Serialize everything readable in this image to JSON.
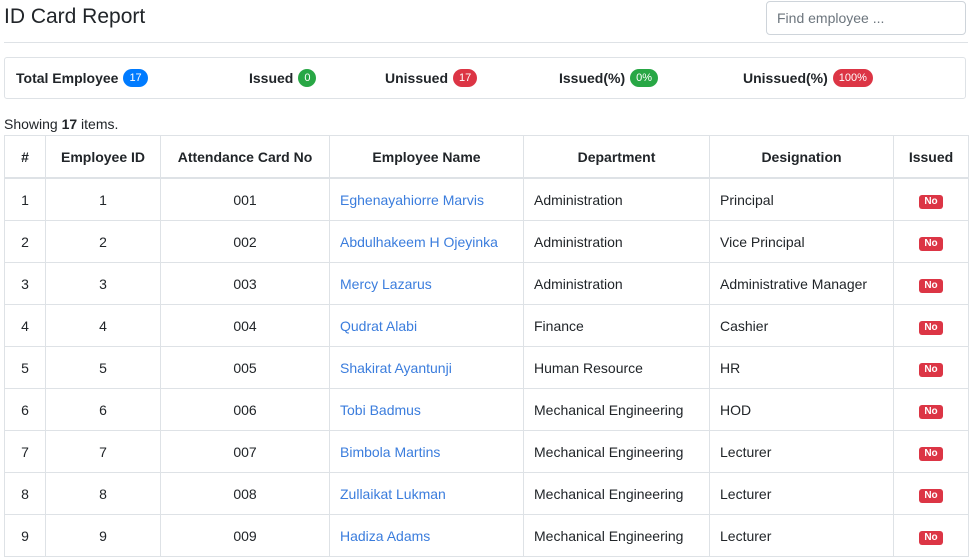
{
  "page": {
    "title": "ID Card Report",
    "search_placeholder": "Find employee ..."
  },
  "summary": {
    "total_label": "Total Employee",
    "total_value": "17",
    "issued_label": "Issued",
    "issued_value": "0",
    "unissued_label": "Unissued",
    "unissued_value": "17",
    "issued_pct_label": "Issued(%)",
    "issued_pct_value": "0%",
    "unissued_pct_label": "Unissued(%)",
    "unissued_pct_value": "100%"
  },
  "showing": {
    "prefix": "Showing ",
    "count": "17",
    "suffix": " items."
  },
  "table": {
    "headers": [
      "#",
      "Employee ID",
      "Attendance Card No",
      "Employee Name",
      "Department",
      "Designation",
      "Issued"
    ],
    "rows": [
      {
        "num": "1",
        "emp_id": "1",
        "card_no": "001",
        "name": "Eghenayahiorre Marvis",
        "department": "Administration",
        "designation": "Principal",
        "issued": "No"
      },
      {
        "num": "2",
        "emp_id": "2",
        "card_no": "002",
        "name": "Abdulhakeem H Ojeyinka",
        "department": "Administration",
        "designation": "Vice Principal",
        "issued": "No"
      },
      {
        "num": "3",
        "emp_id": "3",
        "card_no": "003",
        "name": "Mercy Lazarus",
        "department": "Administration",
        "designation": "Administrative Manager",
        "issued": "No"
      },
      {
        "num": "4",
        "emp_id": "4",
        "card_no": "004",
        "name": "Qudrat Alabi",
        "department": "Finance",
        "designation": "Cashier",
        "issued": "No"
      },
      {
        "num": "5",
        "emp_id": "5",
        "card_no": "005",
        "name": "Shakirat Ayantunji",
        "department": "Human Resource",
        "designation": "HR",
        "issued": "No"
      },
      {
        "num": "6",
        "emp_id": "6",
        "card_no": "006",
        "name": "Tobi Badmus",
        "department": "Mechanical Engineering",
        "designation": "HOD",
        "issued": "No"
      },
      {
        "num": "7",
        "emp_id": "7",
        "card_no": "007",
        "name": "Bimbola Martins",
        "department": "Mechanical Engineering",
        "designation": "Lecturer",
        "issued": "No"
      },
      {
        "num": "8",
        "emp_id": "8",
        "card_no": "008",
        "name": "Zullaikat Lukman",
        "department": "Mechanical Engineering",
        "designation": "Lecturer",
        "issued": "No"
      },
      {
        "num": "9",
        "emp_id": "9",
        "card_no": "009",
        "name": "Hadiza Adams",
        "department": "Mechanical Engineering",
        "designation": "Lecturer",
        "issued": "No"
      }
    ]
  },
  "colors": {
    "primary": "#007bff",
    "success": "#28a745",
    "danger": "#dc3545",
    "link": "#3b7ddd"
  }
}
